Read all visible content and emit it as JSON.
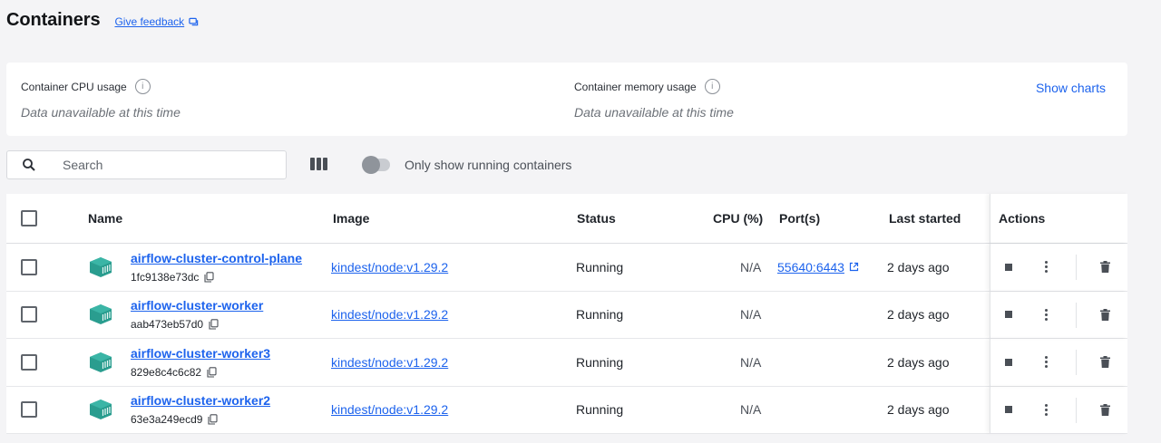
{
  "header": {
    "title": "Containers",
    "feedback_label": "Give feedback"
  },
  "stats": {
    "cpu_label": "Container CPU usage",
    "cpu_value": "Data unavailable at this time",
    "mem_label": "Container memory usage",
    "mem_value": "Data unavailable at this time",
    "show_charts_label": "Show charts"
  },
  "toolbar": {
    "search_placeholder": "Search",
    "running_only_label": "Only show running containers"
  },
  "table": {
    "headers": {
      "name": "Name",
      "image": "Image",
      "status": "Status",
      "cpu": "CPU (%)",
      "ports": "Port(s)",
      "last_started": "Last started",
      "actions": "Actions"
    },
    "rows": [
      {
        "name": "airflow-cluster-control-plane",
        "id": "1fc9138e73dc",
        "image": "kindest/node:v1.29.2",
        "status": "Running",
        "cpu": "N/A",
        "port": "55640:6443",
        "last_started": "2 days ago"
      },
      {
        "name": "airflow-cluster-worker",
        "id": "aab473eb57d0",
        "image": "kindest/node:v1.29.2",
        "status": "Running",
        "cpu": "N/A",
        "port": "",
        "last_started": "2 days ago"
      },
      {
        "name": "airflow-cluster-worker3",
        "id": "829e8c4c6c82",
        "image": "kindest/node:v1.29.2",
        "status": "Running",
        "cpu": "N/A",
        "port": "",
        "last_started": "2 days ago"
      },
      {
        "name": "airflow-cluster-worker2",
        "id": "63e3a249ecd9",
        "image": "kindest/node:v1.29.2",
        "status": "Running",
        "cpu": "N/A",
        "port": "",
        "last_started": "2 days ago"
      }
    ]
  },
  "colors": {
    "accent": "#1d63ed",
    "container_icon": "#2a9d8f",
    "background": "#f4f4f6"
  },
  "icons": [
    "feedback-icon",
    "info-icon",
    "search-icon",
    "columns-icon",
    "toggle-switch",
    "checkbox",
    "container-icon",
    "copy-icon",
    "external-link-icon",
    "stop-icon",
    "more-options-icon",
    "trash-icon"
  ]
}
